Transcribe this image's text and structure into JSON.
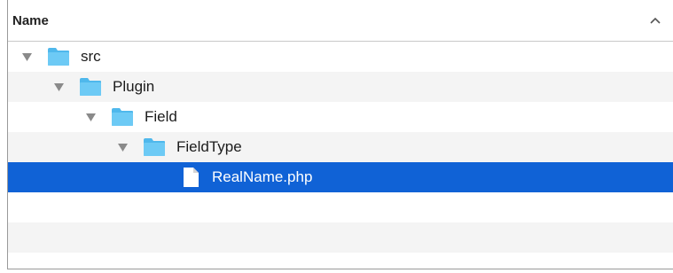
{
  "header": {
    "column_label": "Name",
    "sort_icon": "chevron-up-icon"
  },
  "tree": [
    {
      "label": "src",
      "kind": "folder",
      "expanded": true,
      "depth": 0
    },
    {
      "label": "Plugin",
      "kind": "folder",
      "expanded": true,
      "depth": 1
    },
    {
      "label": "Field",
      "kind": "folder",
      "expanded": true,
      "depth": 2
    },
    {
      "label": "FieldType",
      "kind": "folder",
      "expanded": true,
      "depth": 3
    },
    {
      "label": "RealName.php",
      "kind": "file",
      "selected": true,
      "depth": 4
    }
  ],
  "colors": {
    "selection": "#1062d6",
    "folder": "#5cc2f2",
    "row_alt": "#f4f4f4"
  }
}
